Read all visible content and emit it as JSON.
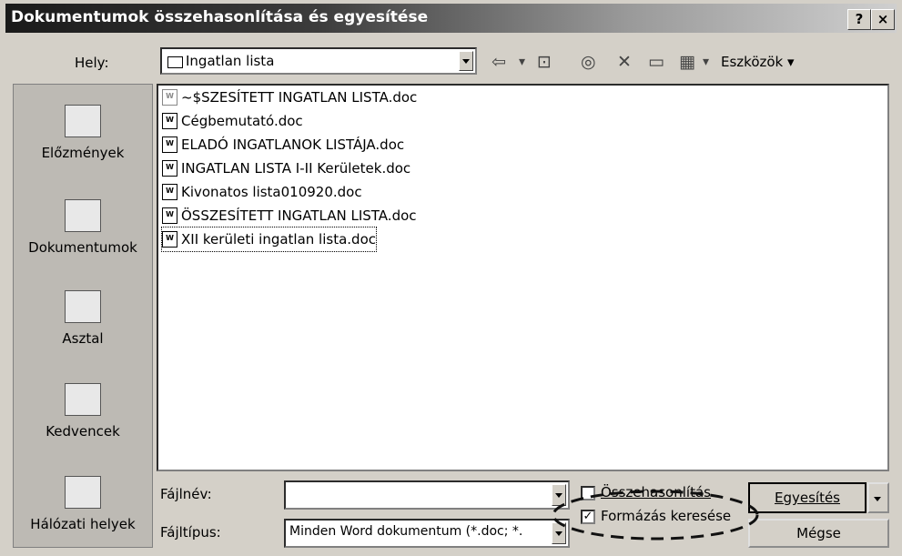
{
  "window": {
    "title": "Dokumentumok összehasonlítása és egyesítése",
    "help_btn": "?",
    "close_btn": "×"
  },
  "toolbar": {
    "location_label": "Hely:",
    "location_value": "Ingatlan lista",
    "back_icon": "⇦",
    "back_dd": "▾",
    "up_icon": "⊡",
    "search_web_icon": "◎",
    "delete_icon": "✕",
    "new_folder_icon": "▭",
    "views_icon": "▦",
    "views_dd": "▾",
    "tools_label": "Eszközök",
    "tools_dd": "▾"
  },
  "places": [
    {
      "label": "Előzmények",
      "icon": "history-icon"
    },
    {
      "label": "Dokumentumok",
      "icon": "my-documents-icon"
    },
    {
      "label": "Asztal",
      "icon": "desktop-icon"
    },
    {
      "label": "Kedvencek",
      "icon": "favorites-icon"
    },
    {
      "label": "Hálózati helyek",
      "icon": "network-places-icon"
    }
  ],
  "files": [
    "~$SZESÍTETT INGATLAN LISTA.doc",
    "Cégbemutató.doc",
    "ELADÓ INGATLANOK LISTÁJA.doc",
    "INGATLAN LISTA I-II Kerületek.doc",
    "Kivonatos lista010920.doc",
    "ÖSSZESÍTETT INGATLAN LISTA.doc",
    "XII kerületi ingatlan lista.doc"
  ],
  "file_icon_text": "W",
  "bottom": {
    "filename_label": "Fájlnév:",
    "filename_value": "",
    "filetype_label": "Fájltípus:",
    "filetype_value": "Minden Word dokumentum (*.doc; *.",
    "compare_label": "Összehasonlítás",
    "compare_checked": false,
    "formatting_label": "Formázás keresése",
    "formatting_checked": true,
    "formatting_check_mark": "✓",
    "merge_button": "Egyesítés",
    "cancel_button": "Mégse"
  }
}
